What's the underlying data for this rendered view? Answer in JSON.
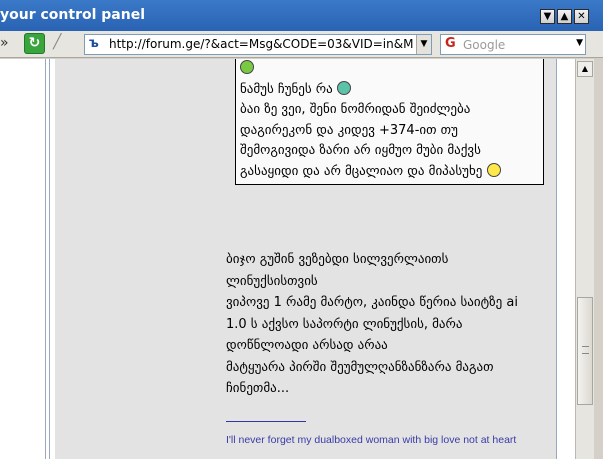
{
  "window": {
    "title": "your control panel",
    "buttons": {
      "minimize": "▼",
      "maximize": "▲",
      "close": "✕"
    }
  },
  "toolbar": {
    "chevron": "»",
    "reload_icon": "↻",
    "stop_icon": "╱",
    "url": "http://forum.ge/?&act=Msg&CODE=03&VID=in&M",
    "url_favicon": "ъ",
    "search_placeholder": "Google",
    "search_engine_icon": "G"
  },
  "quote": {
    "lines": [
      "ნამუს ჩუნეს რა",
      "ბაი ზე ვეი, შენი ნომრიდან შეიძლება",
      "დაგირეკონ და კიდევ +374-ით თუ",
      "შემოგივიდა ზარი არ იყმუო მუბი მაქვს",
      "გასაყიდი და არ მცალიაო და მიპასუხე"
    ]
  },
  "reply": {
    "lines": [
      "ბიჯო გუშინ ვეზებდი სილვერლაითს",
      "ლინუქსისთვის",
      "ვიპოვე 1 რამე მარტო, კაინდა წერია საიტზე ai",
      "1.0 ს აქვსო საპორტი ლინუქსის, მარა",
      "დოწნლოადი არსად არაა",
      "მატყუარა პირში შეუმულღანზანზარა მაგათ",
      "ჩინეთმა..."
    ]
  },
  "signature": "I'll never forget my dualboxed woman with big love not at heart",
  "colors": {
    "titlebar": "#2a63b3",
    "post_background": "#e3e3e3",
    "signature": "#3a3aa8",
    "table_border": "#9aa8c3"
  }
}
